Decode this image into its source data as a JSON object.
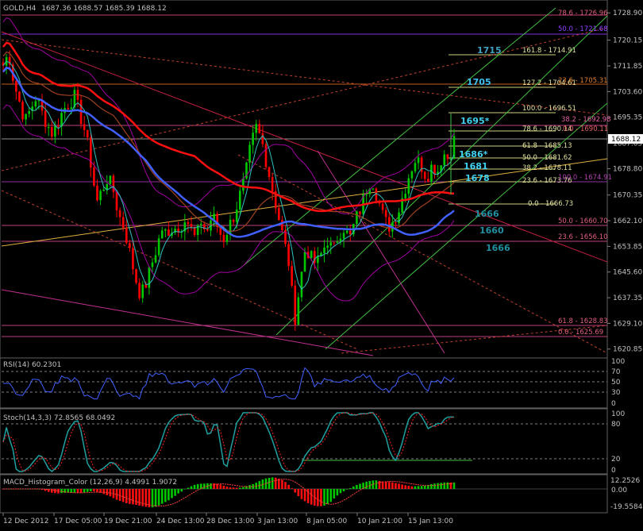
{
  "window": {
    "symbol_title": "GOLD,H4",
    "ohlc_text": "1687.36 1688.57 1685.39 1688.12"
  },
  "current_price": "1688.12",
  "colors": {
    "background": "#000000",
    "bull": "#00c800",
    "bear": "#ff0000",
    "ma_blue": "#4060ff",
    "ma_red": "#ff1010",
    "bollinger": "#b000b0",
    "fib": "#c04080",
    "channel": "#40c040",
    "trend_orange": "#e08020",
    "label_cyan": "#40a0c0",
    "label_fib": "#d0d080",
    "price_box": "#ffffff"
  },
  "main_axis": {
    "ticks": [
      "1728.90",
      "1720.15",
      "1711.85",
      "1703.60",
      "1695.35",
      "1687.05",
      "1678.80",
      "1670.35",
      "1662.10",
      "1653.85",
      "1645.60",
      "1637.35",
      "1629.10",
      "1620.85"
    ]
  },
  "time_axis": {
    "labels": [
      "12 Dec 2012",
      "17 Dec 05:00",
      "19 Dec 21:00",
      "24 Dec 13:00",
      "28 Dec 13:00",
      "3 Jan 13:00",
      "8 Jan 05:00",
      "10 Jan 21:00",
      "15 Jan 13:00"
    ]
  },
  "fib_labels": [
    {
      "text": "78.6 - 1726.96",
      "color": "#e06080"
    },
    {
      "text": "50.0 - 1721.68",
      "color": "#9040ff"
    },
    {
      "text": "161.8 - 1714.91",
      "color": "#e0e0a0"
    },
    {
      "text": "127.2 - 1704.61",
      "color": "#e0e0a0"
    },
    {
      "text": "23.6 - 1705.31",
      "color": "#e08030"
    },
    {
      "text": "100.0 - 1696.51",
      "color": "#e0e0a0"
    },
    {
      "text": "38.2 - 1692.98",
      "color": "#e060a0"
    },
    {
      "text": "78.6 - 1690.14",
      "color": "#e0e0a0"
    },
    {
      "text": "0.0 - 1690.11",
      "color": "#e06060"
    },
    {
      "text": "61.8 - 1685.13",
      "color": "#e0e0a0"
    },
    {
      "text": "50.0 - 1681.62",
      "color": "#e0e0a0"
    },
    {
      "text": "38.2 - 1678.11",
      "color": "#e0e0a0"
    },
    {
      "text": "23.6 - 1673.76",
      "color": "#e0e0a0"
    },
    {
      "text": "100.0 - 1674.91",
      "color": "#b040b0"
    },
    {
      "text": "0.0 - 1666.73",
      "color": "#e0e0a0"
    },
    {
      "text": "50.0 - 1660.70",
      "color": "#e06080"
    },
    {
      "text": "23.6 - 1656.10",
      "color": "#e06080"
    },
    {
      "text": "61.8 - 1628.83",
      "color": "#e06080"
    },
    {
      "text": "0.0 - 1625.69",
      "color": "#e06080"
    }
  ],
  "level_labels": [
    "1715",
    "1705",
    "1695*",
    "1686*",
    "1681",
    "1678",
    "1666",
    "1660",
    "1666"
  ],
  "rsi": {
    "title": "RSI(14) 60.2301",
    "ticks": [
      "100",
      "70",
      "50",
      "30",
      "0"
    ]
  },
  "stoch": {
    "title": "Stoch(14,3,3) 72.8565 68.0492",
    "ticks": [
      "100",
      "80",
      "20",
      "0"
    ]
  },
  "macd": {
    "title": "MACD_Histogram_Color (12,26,9) 4.4991 1.9072",
    "ticks": [
      "12.2526",
      "0.00",
      "-19.5584"
    ]
  },
  "chart_data": {
    "type": "candlestick",
    "symbol": "GOLD",
    "timeframe": "H4",
    "ylim": [
      1619,
      1731
    ],
    "y_ticks": [
      1728.9,
      1720.15,
      1711.85,
      1703.6,
      1695.35,
      1687.05,
      1678.8,
      1670.35,
      1662.1,
      1653.85,
      1645.6,
      1637.35,
      1629.1,
      1620.85
    ],
    "x_labels": [
      "12 Dec 2012",
      "17 Dec 05:00",
      "19 Dec 21:00",
      "24 Dec 13:00",
      "28 Dec 13:00",
      "3 Jan 13:00",
      "8 Jan 05:00",
      "10 Jan 21:00",
      "15 Jan 13:00"
    ],
    "last_price": 1688.12,
    "close_path": [
      1712,
      1716,
      1706,
      1700,
      1694,
      1698,
      1702,
      1697,
      1693,
      1690,
      1694,
      1698,
      1700,
      1702,
      1696,
      1690,
      1680,
      1668,
      1672,
      1676,
      1672,
      1664,
      1660,
      1652,
      1644,
      1638,
      1642,
      1648,
      1654,
      1660,
      1656,
      1662,
      1658,
      1664,
      1660,
      1656,
      1662,
      1658,
      1664,
      1660,
      1656,
      1660,
      1664,
      1670,
      1676,
      1686,
      1692,
      1688,
      1680,
      1672,
      1664,
      1656,
      1648,
      1630,
      1642,
      1654,
      1650,
      1648,
      1652,
      1656,
      1652,
      1658,
      1660,
      1656,
      1662,
      1666,
      1672,
      1676,
      1670,
      1664,
      1660,
      1662,
      1666,
      1672,
      1678,
      1682,
      1680,
      1676,
      1680,
      1678,
      1684,
      1682,
      1688
    ],
    "indicators": [
      {
        "name": "RSI(14)",
        "value": 60.2301,
        "levels": [
          70,
          50,
          30
        ],
        "range": [
          0,
          100
        ]
      },
      {
        "name": "Stoch(14,3,3)",
        "main": 72.8565,
        "signal": 68.0492,
        "levels": [
          80,
          20
        ],
        "range": [
          0,
          100
        ]
      },
      {
        "name": "MACD_Histogram_Color (12,26,9)",
        "values": [
          4.4991,
          1.9072
        ],
        "range": [
          -19.5584,
          12.2526
        ]
      }
    ]
  }
}
